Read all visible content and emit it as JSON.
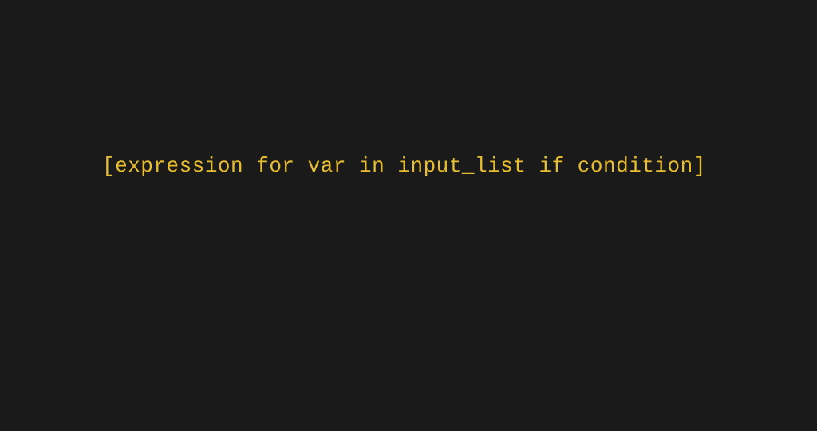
{
  "code": {
    "line1": "[expression for var in input_list if condition]"
  },
  "colors": {
    "background": "#1a1a1a",
    "text": "#e8be2e"
  }
}
